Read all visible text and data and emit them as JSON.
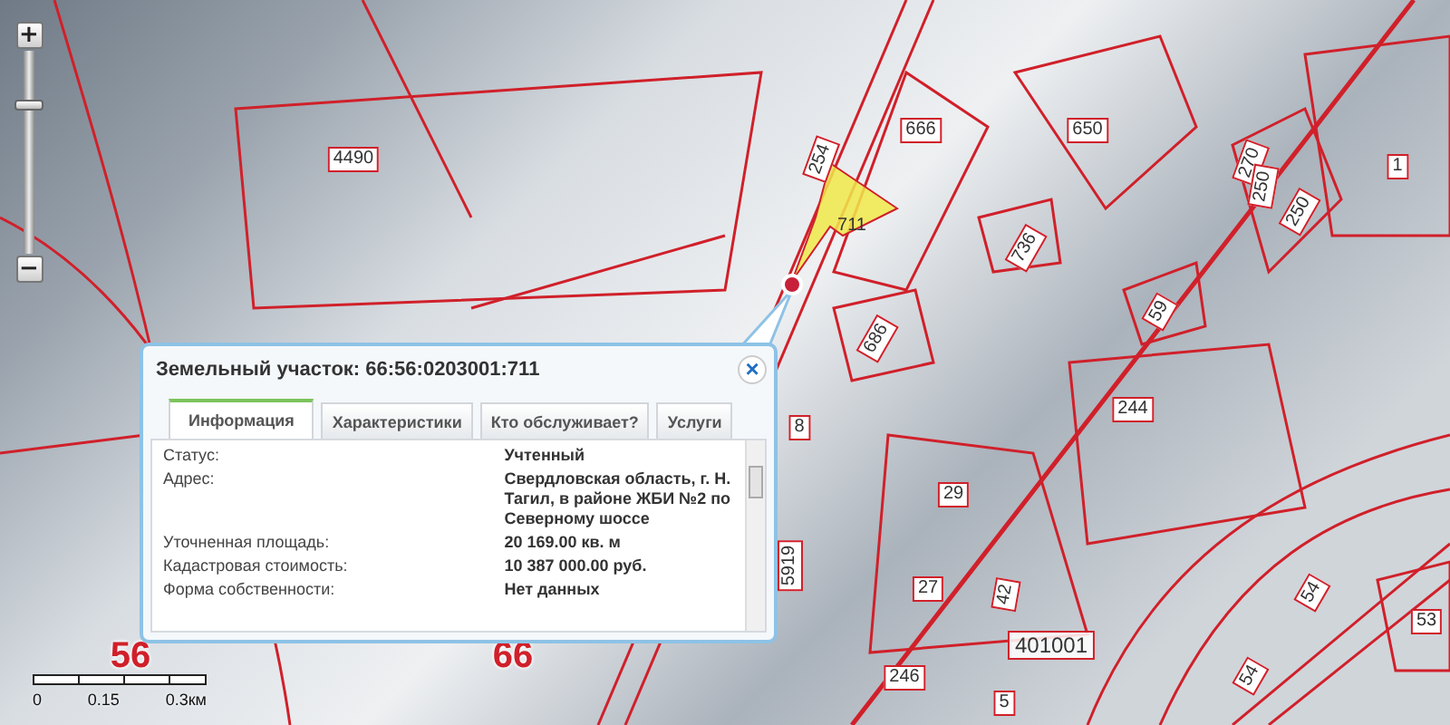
{
  "map": {
    "parcel_labels": [
      {
        "text": "4490",
        "kind": "parcel"
      },
      {
        "text": "254",
        "kind": "parcel"
      },
      {
        "text": "666",
        "kind": "parcel"
      },
      {
        "text": "650",
        "kind": "parcel"
      },
      {
        "text": "711",
        "kind": "selected"
      },
      {
        "text": "736",
        "kind": "parcel"
      },
      {
        "text": "686",
        "kind": "parcel"
      },
      {
        "text": "270",
        "kind": "parcel"
      },
      {
        "text": "250",
        "kind": "parcel"
      },
      {
        "text": "250",
        "kind": "parcel"
      },
      {
        "text": "1",
        "kind": "parcel"
      },
      {
        "text": "59",
        "kind": "parcel"
      },
      {
        "text": "244",
        "kind": "parcel"
      },
      {
        "text": "8",
        "kind": "parcel"
      },
      {
        "text": "29",
        "kind": "parcel"
      },
      {
        "text": "5919",
        "kind": "parcel"
      },
      {
        "text": "27",
        "kind": "parcel"
      },
      {
        "text": "42",
        "kind": "parcel"
      },
      {
        "text": "401001",
        "kind": "block"
      },
      {
        "text": "246",
        "kind": "parcel"
      },
      {
        "text": "5",
        "kind": "parcel"
      },
      {
        "text": "54",
        "kind": "parcel"
      },
      {
        "text": "54",
        "kind": "parcel"
      },
      {
        "text": "53",
        "kind": "parcel"
      },
      {
        "text": "56",
        "kind": "quarter"
      },
      {
        "text": "66",
        "kind": "quarter"
      }
    ]
  },
  "zoom": {
    "plus": "+",
    "minus": "−",
    "level": 0.73
  },
  "scale": {
    "ticks": [
      "0",
      "0.15",
      "0.3км"
    ]
  },
  "popup": {
    "title": "Земельный участок: 66:56:0203001:711",
    "close": "×",
    "tabs": [
      {
        "label": "Информация",
        "selected": true
      },
      {
        "label": "Характеристики",
        "selected": false
      },
      {
        "label": "Кто обслуживает?",
        "selected": false
      },
      {
        "label": "Услуги",
        "selected": false
      }
    ],
    "rows": [
      {
        "label": "Статус:",
        "value": "Учтенный"
      },
      {
        "label": "Адрес:",
        "value": "Свердловская область, г. Н. Тагил, в районе ЖБИ №2 по Северному шоссе"
      },
      {
        "label": "Уточненная площадь:",
        "value": "20 169.00 кв. м"
      },
      {
        "label": "Кадастровая стоимость:",
        "value": "10 387 000.00 руб."
      },
      {
        "label": "Форма собственности:",
        "value": "Нет данных"
      }
    ]
  }
}
